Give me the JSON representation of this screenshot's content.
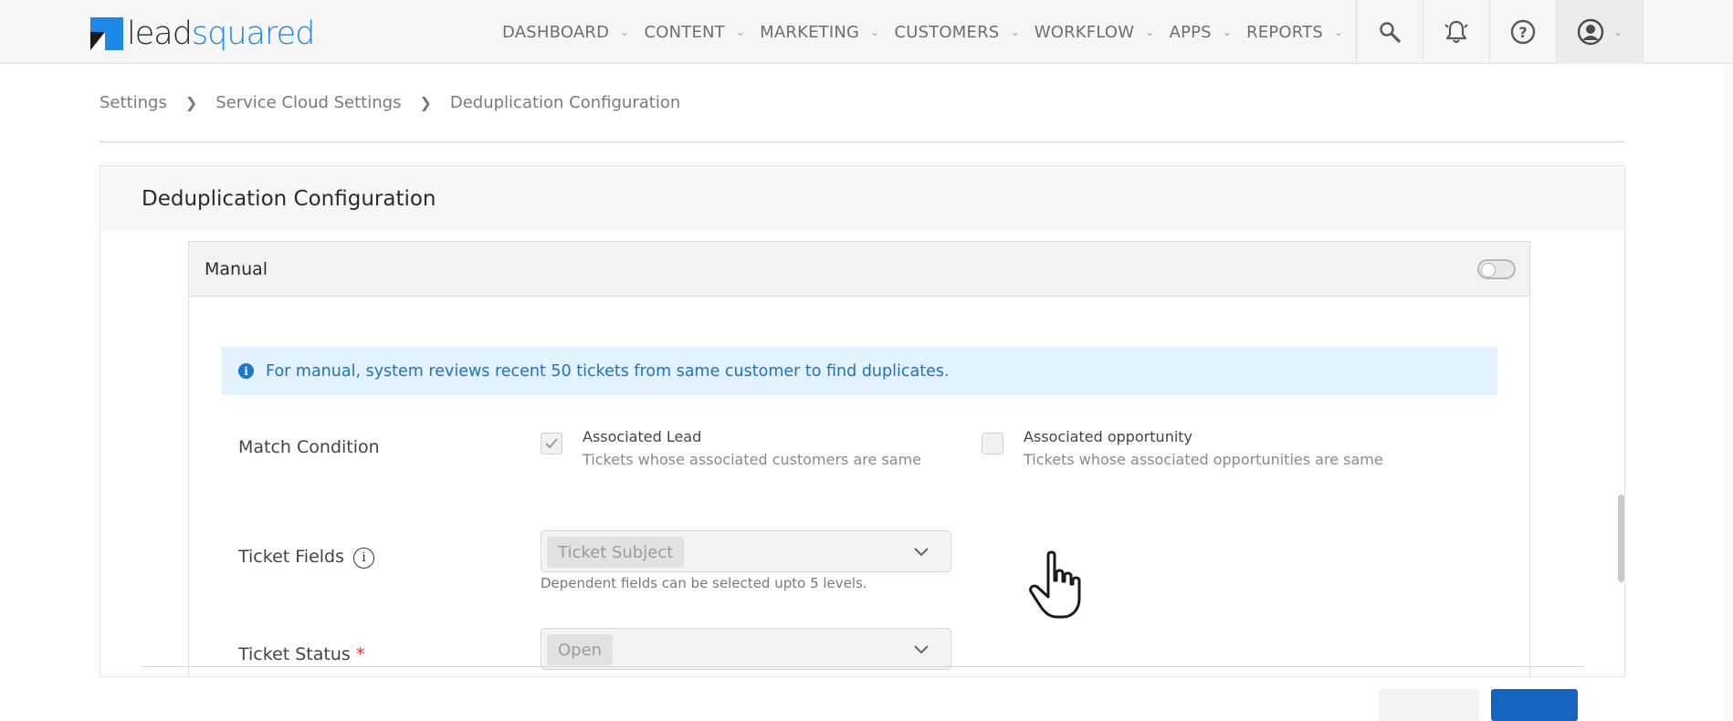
{
  "app": {
    "logo": {
      "part1": "lead",
      "part2": "squared"
    },
    "nav": [
      {
        "label": "DASHBOARD"
      },
      {
        "label": "CONTENT"
      },
      {
        "label": "MARKETING"
      },
      {
        "label": "CUSTOMERS"
      },
      {
        "label": "WORKFLOW"
      },
      {
        "label": "APPS"
      },
      {
        "label": "REPORTS"
      }
    ],
    "icons": [
      "search-icon",
      "bell-icon",
      "help-icon",
      "user-profile-icon"
    ]
  },
  "breadcrumb": [
    "Settings",
    "Service Cloud Settings",
    "Deduplication Configuration"
  ],
  "page": {
    "title": "Deduplication Configuration",
    "panel": {
      "title": "Manual",
      "toggle_on": false,
      "info": "For manual, system reviews recent 50 tickets from same customer to find duplicates.",
      "match_condition": {
        "label": "Match Condition",
        "options": [
          {
            "title": "Associated Lead",
            "subtitle": "Tickets whose associated customers are same",
            "checked": true
          },
          {
            "title": "Associated opportunity",
            "subtitle": "Tickets whose associated opportunities are same",
            "checked": false
          }
        ]
      },
      "ticket_fields": {
        "label": "Ticket Fields",
        "selected": "Ticket Subject",
        "hint": "Dependent fields can be selected upto 5 levels."
      },
      "ticket_status": {
        "label": "Ticket Status",
        "required": "*",
        "selected": "Open"
      }
    }
  },
  "colors": {
    "accent": "#1e88e5",
    "info_bg": "#e3f2fd",
    "info_text": "#1e73be",
    "primary_button": "#1565c0"
  }
}
